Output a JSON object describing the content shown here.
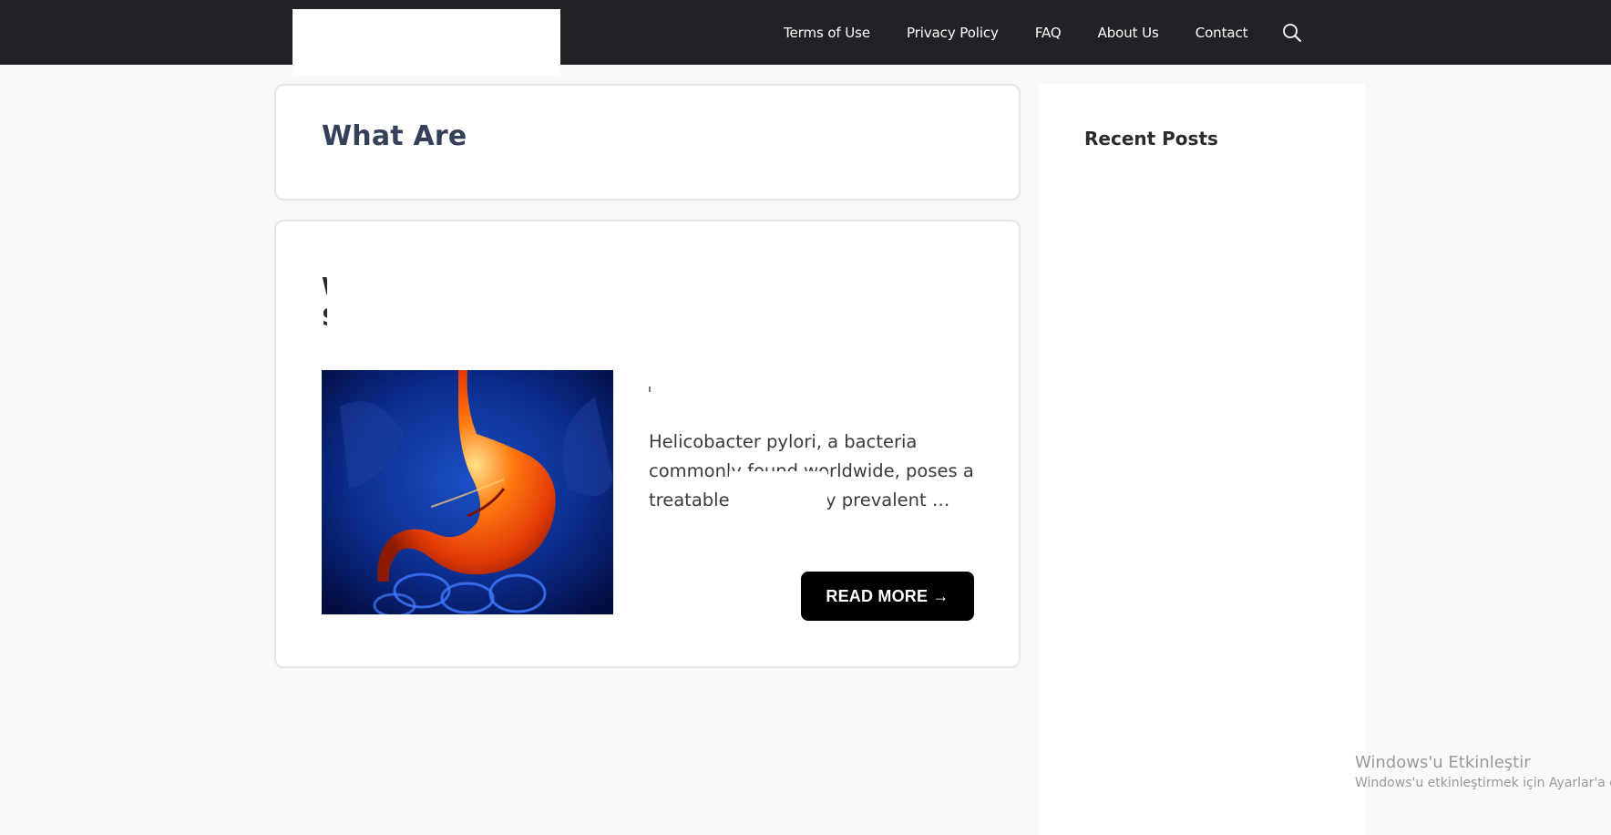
{
  "header": {
    "nav_items": [
      "Terms of Use",
      "Privacy Policy",
      "FAQ",
      "About Us",
      "Contact"
    ],
    "search_icon": "search-icon",
    "background": "#222226"
  },
  "archive": {
    "title": "What Are"
  },
  "post": {
    "title_fragment": "W S",
    "excerpt": "Helicobacter pylori, a bacteria commonly found worldwide, poses a treatable particularly prevalent …",
    "read_more_label": "READ MORE →",
    "thumbnail": "stomach-illustration-image"
  },
  "sidebar": {
    "title": "Recent Posts"
  },
  "watermark": {
    "line1": "Windows'u Etkinleştir",
    "line2": "Windows'u etkinleştirmek için Ayarlar'a gidin."
  }
}
